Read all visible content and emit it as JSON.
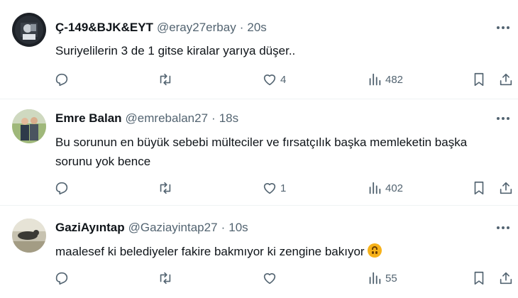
{
  "tweets": [
    {
      "name": "Ç-149&BJK&EYT",
      "handle": "@eray27erbay",
      "separator": "·",
      "time": "20s",
      "text": "Suriyelilerin 3 de 1 gitse kiralar yarıya düşer..",
      "likes": "4",
      "views": "482",
      "avatar_icon": "avatar-photo"
    },
    {
      "name": "Emre Balan",
      "handle": "@emrebalan27",
      "separator": "·",
      "time": "18s",
      "text": "Bu sorunun en büyük sebebi mülteciler ve fırsatçılık başka memleketin başka sorunu yok bence",
      "likes": "1",
      "views": "402",
      "avatar_icon": "avatar-photo"
    },
    {
      "name": "GaziAyıntap",
      "handle": "@Gaziayintap27",
      "separator": "·",
      "time": "10s",
      "text": "maalesef ki belediyeler fakire bakmıyor ki zengine bakıyor",
      "likes": "",
      "views": "55",
      "avatar_icon": "avatar-photo",
      "emoji": "upside-down-face"
    }
  ],
  "colors": {
    "text": "#0f1419",
    "secondary": "#536471",
    "divider": "#eff3f4",
    "emoji": "#f7b21a"
  }
}
